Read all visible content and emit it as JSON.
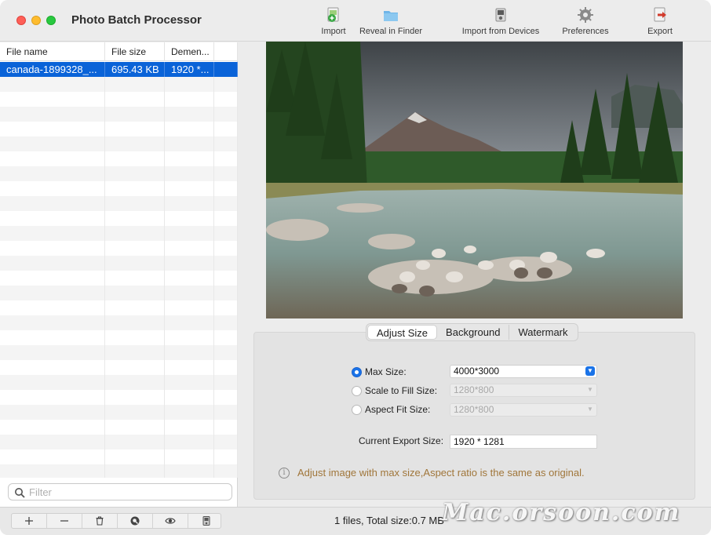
{
  "window": {
    "title": "Photo Batch Processor"
  },
  "toolbar": {
    "items": [
      {
        "label": "Import",
        "icon": "import-icon"
      },
      {
        "label": "Reveal in Finder",
        "icon": "folder-icon"
      },
      {
        "label": "Import from Devices",
        "icon": "camera-icon"
      },
      {
        "label": "Preferences",
        "icon": "gear-icon"
      },
      {
        "label": "Export",
        "icon": "export-icon"
      }
    ]
  },
  "file_table": {
    "columns": [
      "File name",
      "File size",
      "Demen..."
    ],
    "rows": [
      {
        "name": "canada-1899328_...",
        "size": "695.43 KB",
        "dimensions": "1920 *...",
        "selected": true
      }
    ]
  },
  "filter": {
    "placeholder": "Filter"
  },
  "tabs": {
    "items": [
      "Adjust Size",
      "Background",
      "Watermark"
    ],
    "active": "Adjust Size"
  },
  "adjust_size": {
    "options": [
      {
        "label": "Max Size:",
        "value": "4000*3000",
        "selected": true,
        "enabled": true
      },
      {
        "label": "Scale to Fill Size:",
        "value": "1280*800",
        "selected": false,
        "enabled": false
      },
      {
        "label": "Aspect Fit Size:",
        "value": "1280*800",
        "selected": false,
        "enabled": false
      }
    ],
    "current_export_label": "Current Export Size:",
    "current_export_value": "1920 * 1281",
    "info_text": "Adjust image with max size,Aspect ratio is the same as original."
  },
  "status": {
    "text": "1 files, Total size:0.7 MB"
  },
  "watermark_text": "Mac.orsoon.com",
  "colors": {
    "selection": "#0a63d8",
    "accent": "#1a73e8",
    "info_text": "#a0763a"
  }
}
